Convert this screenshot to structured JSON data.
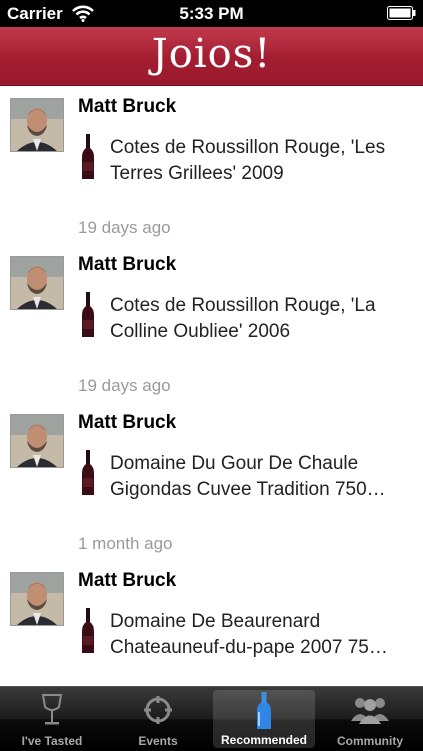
{
  "status_bar": {
    "carrier": "Carrier",
    "time": "5:33 PM"
  },
  "nav": {
    "title": "Joios!"
  },
  "feed": [
    {
      "user": "Matt Bruck",
      "wine": "Cotes de Roussillon Rouge, 'Les Terres Grillees' 2009",
      "time": "19 days ago"
    },
    {
      "user": "Matt Bruck",
      "wine": "Cotes de Roussillon Rouge, 'La Colline Oubliee' 2006",
      "time": "19 days ago"
    },
    {
      "user": "Matt Bruck",
      "wine": "Domaine Du Gour De Chaule Gigondas Cuvee Tradition 750…",
      "time": "1 month ago"
    },
    {
      "user": "Matt Bruck",
      "wine": "Domaine De Beaurenard Chateauneuf-du-pape 2007 75…",
      "time": ""
    }
  ],
  "tabs": [
    {
      "label": "I've Tasted",
      "icon": "wine-glass-icon"
    },
    {
      "label": "Events",
      "icon": "crosshair-icon"
    },
    {
      "label": "Recommended",
      "icon": "bottle-icon",
      "selected": true
    },
    {
      "label": "Community",
      "icon": "people-icon"
    }
  ],
  "colors": {
    "nav_red": "#a31d31",
    "time_gray": "#9a9a9a"
  }
}
